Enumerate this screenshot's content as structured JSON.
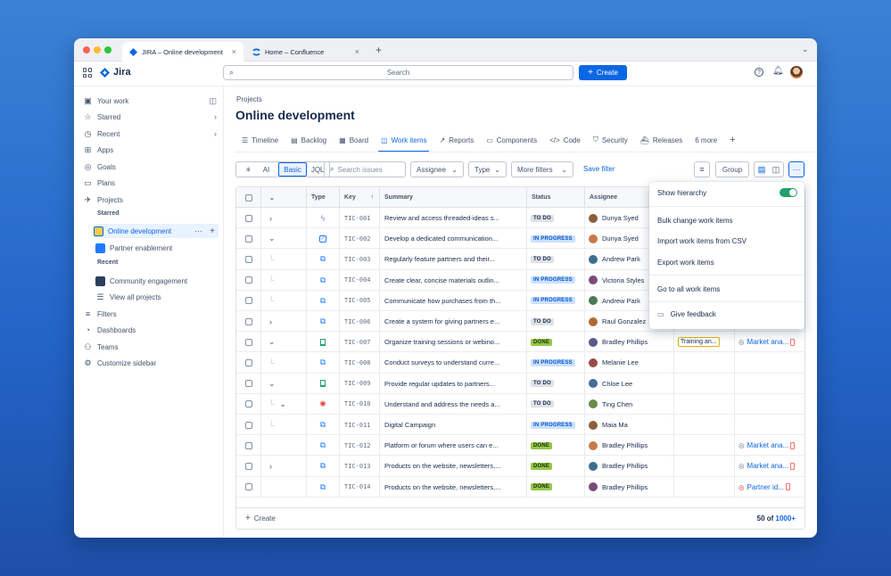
{
  "browser": {
    "tabs": [
      {
        "title": "JIRA – Online development"
      },
      {
        "title": "Home – Confluence"
      }
    ]
  },
  "topnav": {
    "app_name": "Jira",
    "search_placeholder": "Search",
    "create_label": "Create"
  },
  "sidebar": {
    "your_work": "Your work",
    "starred": "Starred",
    "recent": "Recent",
    "apps": "Apps",
    "goals": "Goals",
    "plans": "Plans",
    "projects": "Projects",
    "section_starred": "Starred",
    "starred_projects": [
      "Online development",
      "Partner enablement"
    ],
    "section_recent": "Recent",
    "recent_projects": [
      "Community engagement"
    ],
    "view_all": "View all projects",
    "filters": "Filters",
    "dashboards": "Dashboards",
    "teams": "Teams",
    "customize": "Customize sidebar"
  },
  "header": {
    "breadcrumb": "Projects",
    "title": "Online development",
    "tabs": [
      "Timeline",
      "Backlog",
      "Board",
      "Work items",
      "Reports",
      "Components",
      "Code",
      "Security",
      "Releases",
      "6 more"
    ]
  },
  "filters": {
    "ai": "AI",
    "basic": "Basic",
    "jql": "JQL",
    "search_placeholder": "Search issues",
    "assignee": "Assignee",
    "type": "Type",
    "more_filters": "More filters",
    "save_filter": "Save filter",
    "group": "Group"
  },
  "table": {
    "headers": [
      "Type",
      "Key",
      "Summary",
      "Status",
      "Assignee"
    ],
    "rows": [
      {
        "key": "TIC-001",
        "summary": "Review and access threaded-ideas s...",
        "status": "TO DO",
        "assignee": "Dunya Syed",
        "type": "subtask",
        "expand": "right",
        "extra": ""
      },
      {
        "key": "TIC-002",
        "summary": "Develop a dedicated communication...",
        "status": "IN PROGRESS",
        "assignee": "Dunya Syed",
        "type": "task",
        "expand": "down",
        "extra": ""
      },
      {
        "key": "TIC-003",
        "summary": "Regularly feature partners and their...",
        "status": "TO DO",
        "assignee": "Andrew Park",
        "type": "subtask2",
        "expand": "child",
        "extra": ""
      },
      {
        "key": "TIC-004",
        "summary": "Create clear, concise materials outlin...",
        "status": "IN PROGRESS",
        "assignee": "Victoria Styles",
        "type": "subtask2",
        "expand": "child",
        "extra": ""
      },
      {
        "key": "TIC-005",
        "summary": "Communicate how purchases from th...",
        "status": "IN PROGRESS",
        "assignee": "Andrew Park",
        "type": "subtask2",
        "expand": "child",
        "extra": ""
      },
      {
        "key": "TIC-006",
        "summary": "Create a system for giving partners e...",
        "status": "TO DO",
        "assignee": "Raul Gonzalez",
        "type": "subtask2",
        "expand": "right",
        "extra": ""
      },
      {
        "key": "TIC-007",
        "summary": "Organize training sessions or webino...",
        "status": "DONE",
        "assignee": "Bradley Phillips",
        "type": "story",
        "expand": "down",
        "extra": "Training an...",
        "extra2": "Market ana..."
      },
      {
        "key": "TIC-008",
        "summary": "Conduct surveys to understand curre...",
        "status": "IN PROGRESS",
        "assignee": "Melanie Lee",
        "type": "subtask2",
        "expand": "child",
        "extra": ""
      },
      {
        "key": "TIC-009",
        "summary": "Provide regular updates to partners...",
        "status": "TO DO",
        "assignee": "Chloe Lee",
        "type": "story",
        "expand": "down",
        "extra": ""
      },
      {
        "key": "TIC-010",
        "summary": "Understand and address the needs a...",
        "status": "TO DO",
        "assignee": "Ting Chen",
        "type": "bug",
        "expand": "childdown",
        "extra": ""
      },
      {
        "key": "TIC-011",
        "summary": "Digital Campaign",
        "status": "IN PROGRESS",
        "assignee": "Maia Ma",
        "type": "subtask2",
        "expand": "child",
        "extra": ""
      },
      {
        "key": "TIC-012",
        "summary": "Platform or forum where users can e...",
        "status": "DONE",
        "assignee": "Bradley Phillips",
        "type": "subtask2",
        "expand": "",
        "extra": "",
        "extra2": "Market ana..."
      },
      {
        "key": "TIC-013",
        "summary": "Products on the website, newsletters,...",
        "status": "DONE",
        "assignee": "Bradley Phillips",
        "type": "subtask2",
        "expand": "right",
        "extra": "",
        "extra2": "Market ana..."
      },
      {
        "key": "TIC-014",
        "summary": "Products on the website, newsletters,...",
        "status": "DONE",
        "assignee": "Bradley Phillips",
        "type": "subtask2",
        "expand": "",
        "extra": "",
        "extra2": "Partner id..."
      }
    ],
    "footer_create": "Create",
    "count_prefix": "50 of",
    "count_total": "1000+"
  },
  "menu": {
    "show_hierarchy": "Show hierarchy",
    "bulk_change": "Bulk change work items",
    "import_csv": "Import work items from CSV",
    "export": "Export work items",
    "go_all": "Go to all work items",
    "feedback": "Give feedback"
  },
  "colors": {
    "brand": "#0c66e4",
    "done": "#94c748",
    "in_progress": "#cce0ff",
    "todo": "#dfe1e6"
  }
}
